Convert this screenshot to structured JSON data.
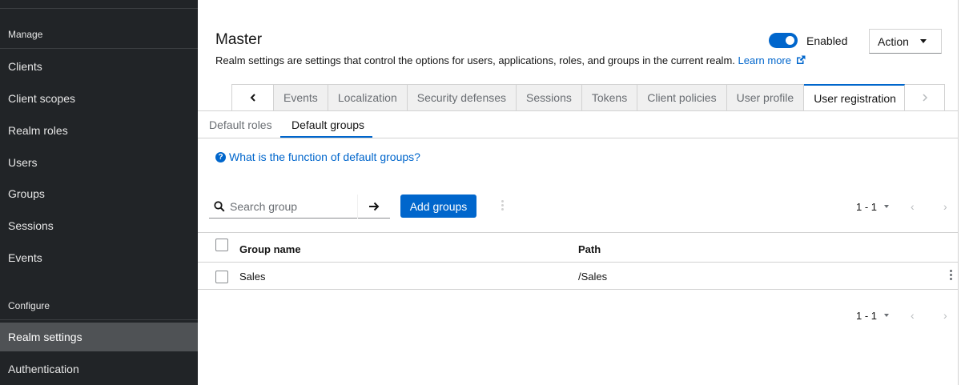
{
  "sidebar": {
    "sections": [
      {
        "label": "Manage"
      },
      {
        "label": "Configure"
      }
    ],
    "manage_items": [
      {
        "label": "Clients"
      },
      {
        "label": "Client scopes"
      },
      {
        "label": "Realm roles"
      },
      {
        "label": "Users"
      },
      {
        "label": "Groups"
      },
      {
        "label": "Sessions"
      },
      {
        "label": "Events"
      }
    ],
    "configure_items": [
      {
        "label": "Realm settings",
        "active": true
      },
      {
        "label": "Authentication"
      }
    ]
  },
  "header": {
    "title": "Master",
    "description": "Realm settings are settings that control the options for users, applications, roles, and groups in the current realm.",
    "learn_more": "Learn more",
    "enabled_label": "Enabled",
    "enabled": true,
    "action_label": "Action"
  },
  "tabs": {
    "items": [
      {
        "label": "Events"
      },
      {
        "label": "Localization"
      },
      {
        "label": "Security defenses"
      },
      {
        "label": "Sessions"
      },
      {
        "label": "Tokens"
      },
      {
        "label": "Client policies"
      },
      {
        "label": "User profile"
      },
      {
        "label": "User registration",
        "active": true
      }
    ]
  },
  "subtabs": {
    "items": [
      {
        "label": "Default roles"
      },
      {
        "label": "Default groups",
        "active": true
      }
    ]
  },
  "help_link": "What is the function of default groups?",
  "toolbar": {
    "search_placeholder": "Search group",
    "add_button": "Add groups",
    "pagination_range": "1 - 1"
  },
  "table": {
    "columns": [
      "Group name",
      "Path"
    ],
    "rows": [
      {
        "name": "Sales",
        "path": "/Sales"
      }
    ]
  },
  "colors": {
    "sidebar_bg": "#212427",
    "sidebar_active": "#4f5255",
    "accent": "#0066cc"
  }
}
